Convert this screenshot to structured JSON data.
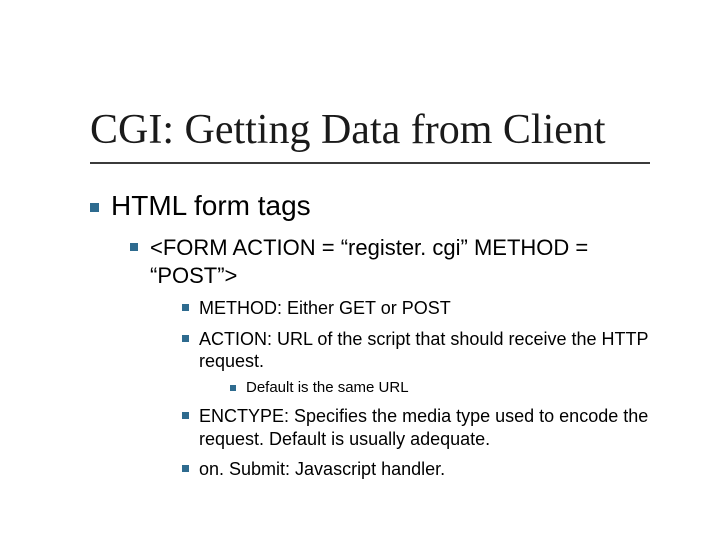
{
  "title": "CGI: Getting Data from Client",
  "lvl1": {
    "item1": "HTML form tags"
  },
  "lvl2": {
    "item1": "<FORM ACTION = “register. cgi” METHOD = “POST”>"
  },
  "lvl3": {
    "method": "METHOD: Either GET or POST",
    "action": "ACTION: URL of the script that should receive the HTTP request.",
    "enctype": "ENCTYPE: Specifies the media type used to encode the request. Default is usually adequate.",
    "onsubmit": "on. Submit: Javascript handler."
  },
  "lvl4": {
    "default_url": "Default is the same URL"
  },
  "colors": {
    "bullet": "#2e6b8f"
  }
}
